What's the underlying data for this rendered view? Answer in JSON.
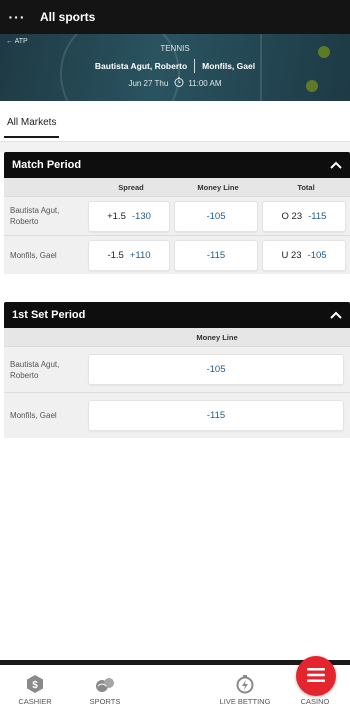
{
  "header": {
    "title": "All sports",
    "menu_icon": "ellipsis-icon"
  },
  "event": {
    "back_label": "ATP",
    "sport": "TENNIS",
    "home": "Bautista Agut, Roberto",
    "away": "Monfils, Gael",
    "date": "Jun 27 Thu",
    "time": "11:00 AM"
  },
  "tabs": {
    "all_markets": "All Markets"
  },
  "match_period": {
    "title": "Match Period",
    "columns": [
      "Spread",
      "Money Line",
      "Total"
    ],
    "rows": [
      {
        "player": "Bautista Agut, Roberto",
        "spread_line": "+1.5",
        "spread_odds": "-130",
        "moneyline": "-105",
        "total_line": "O 23",
        "total_odds": "-115"
      },
      {
        "player": "Monfils, Gael",
        "spread_line": "-1.5",
        "spread_odds": "+110",
        "moneyline": "-115",
        "total_line": "U 23",
        "total_odds": "-105"
      }
    ]
  },
  "first_set": {
    "title": "1st Set Period",
    "columns": [
      "Money Line"
    ],
    "rows": [
      {
        "player": "Bautista Agut, Roberto",
        "moneyline": "-105"
      },
      {
        "player": "Monfils, Gael",
        "moneyline": "-115"
      }
    ]
  },
  "bottom_nav": [
    {
      "label": "CASHIER",
      "icon": "cashier-icon"
    },
    {
      "label": "SPORTS",
      "icon": "sports-icon"
    },
    {
      "label": "",
      "icon": "menu-icon"
    },
    {
      "label": "LIVE BETTING",
      "icon": "live-betting-icon"
    },
    {
      "label": "CASINO",
      "icon": "casino-icon"
    }
  ],
  "colors": {
    "accent": "#e5252d",
    "odds": "#1f5a89",
    "header_bg": "#141414"
  }
}
